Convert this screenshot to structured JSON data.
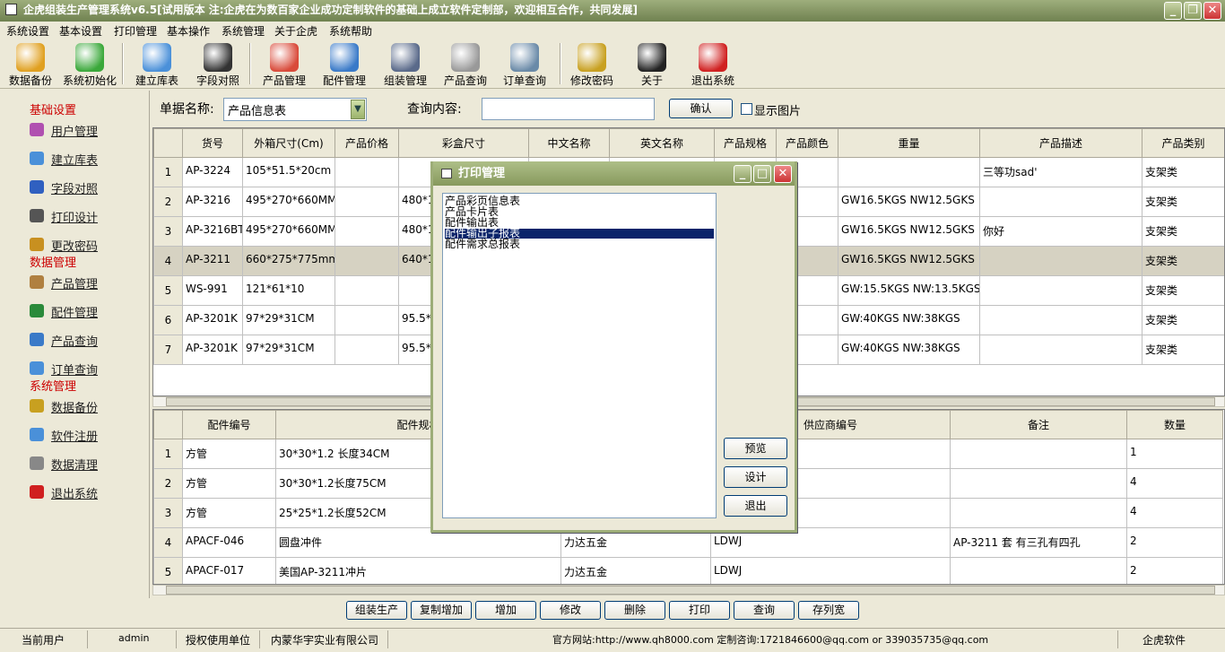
{
  "window": {
    "title": "企虎组装生产管理系统v6.5[试用版本 注:企虎在为数百家企业成功定制软件的基础上成立软件定制部，欢迎相互合作，共同发展]"
  },
  "menu": [
    "系统设置",
    "基本设置",
    "打印管理",
    "基本操作",
    "系统管理",
    "关于企虎",
    "系统帮助"
  ],
  "toolbar": [
    {
      "label": "数据备份",
      "icon": "database-backup-icon",
      "color": "#e0a020"
    },
    {
      "label": "系统初始化",
      "icon": "refresh-icon",
      "color": "#3aa83a"
    },
    {
      "label": "建立库表",
      "icon": "form-icon",
      "color": "#4a90d9"
    },
    {
      "label": "字段对照",
      "icon": "amazon-a-icon",
      "color": "#333333"
    },
    {
      "label": "产品管理",
      "icon": "chrome-icon",
      "color": "#d94a3a"
    },
    {
      "label": "配件管理",
      "icon": "tools-icon",
      "color": "#3a7ac8"
    },
    {
      "label": "组装管理",
      "icon": "database-icon",
      "color": "#5a6a8a"
    },
    {
      "label": "产品查询",
      "icon": "magnifier-icon",
      "color": "#999999"
    },
    {
      "label": "订单查询",
      "icon": "database-search-icon",
      "color": "#6a8aa8"
    },
    {
      "label": "修改密码",
      "icon": "lock-icon",
      "color": "#c8a020"
    },
    {
      "label": "关于",
      "icon": "gnome-icon",
      "color": "#222222"
    },
    {
      "label": "退出系统",
      "icon": "cube-exit-icon",
      "color": "#d02020"
    }
  ],
  "sidebar": {
    "sections": [
      {
        "title": "基础设置",
        "items": [
          {
            "label": "用户管理",
            "color": "#b050b0"
          },
          {
            "label": "建立库表",
            "color": "#4a90d9"
          },
          {
            "label": "字段对照",
            "color": "#3060c0"
          },
          {
            "label": "打印设计",
            "color": "#555555"
          },
          {
            "label": "更改密码",
            "color": "#c89020"
          }
        ]
      },
      {
        "title": "数据管理",
        "items": [
          {
            "label": "产品管理",
            "color": "#b08040"
          },
          {
            "label": "配件管理",
            "color": "#2a8a3a"
          },
          {
            "label": "产品查询",
            "color": "#3a7ac8"
          },
          {
            "label": "订单查询",
            "color": "#4a90d9"
          }
        ]
      },
      {
        "title": "系统管理",
        "items": [
          {
            "label": "数据备份",
            "color": "#c8a020"
          },
          {
            "label": "软件注册",
            "color": "#4a90d9"
          },
          {
            "label": "数据清理",
            "color": "#888888"
          },
          {
            "label": "退出系统",
            "color": "#d02020"
          }
        ]
      }
    ]
  },
  "search": {
    "doc_label": "单据名称:",
    "doc_value": "产品信息表",
    "query_label": "查询内容:",
    "query_value": "",
    "confirm": "确认",
    "show_pic": "显示图片"
  },
  "top_grid": {
    "columns": [
      "货号",
      "外箱尺寸(Cm)",
      "产品价格",
      "彩盒尺寸",
      "中文名称",
      "英文名称",
      "产品规格",
      "产品颜色",
      "重量",
      "产品描述",
      "产品类别"
    ],
    "rows": [
      {
        "n": "1",
        "c": [
          "AP-3224",
          "105*51.5*20cm",
          "",
          "",
          "",
          "",
          "",
          "",
          "",
          "三等功sad'",
          "支架类"
        ]
      },
      {
        "n": "2",
        "c": [
          "AP-3216",
          "495*270*660MM",
          "",
          "480*1",
          "",
          "",
          "",
          "",
          "GW16.5KGS NW12.5GKS",
          "",
          "支架类"
        ]
      },
      {
        "n": "3",
        "c": [
          "AP-3216BT",
          "495*270*660MM",
          "",
          "480*1",
          "",
          "",
          "",
          "",
          "GW16.5KGS NW12.5GKS",
          "你好",
          "支架类"
        ]
      },
      {
        "n": "4",
        "c": [
          "AP-3211",
          "660*275*775mm",
          "",
          "640*1",
          "",
          "",
          "",
          "",
          "GW16.5KGS NW12.5GKS",
          "",
          "支架类"
        ]
      },
      {
        "n": "5",
        "c": [
          "WS-991",
          "121*61*10",
          "",
          "",
          "",
          "",
          "",
          "",
          "GW:15.5KGS NW:13.5KGS",
          "",
          "支架类"
        ]
      },
      {
        "n": "6",
        "c": [
          "AP-3201K",
          "97*29*31CM",
          "",
          "95.5*9",
          "",
          "",
          "",
          "",
          "GW:40KGS  NW:38KGS",
          "",
          "支架类"
        ]
      },
      {
        "n": "7",
        "c": [
          "AP-3201K",
          "97*29*31CM",
          "",
          "95.5*9",
          "",
          "",
          "",
          "",
          "GW:40KGS  NW:38KGS",
          "",
          "支架类"
        ]
      }
    ]
  },
  "bottom_grid": {
    "columns": [
      "配件编号",
      "配件规格",
      "",
      "供应商编号",
      "备注",
      "数量"
    ],
    "rows": [
      {
        "n": "1",
        "c": [
          "方管",
          "30*30*1.2  长度34CM",
          "",
          "",
          "",
          "1"
        ]
      },
      {
        "n": "2",
        "c": [
          "方管",
          "30*30*1.2长度75CM",
          "",
          "",
          "",
          "4"
        ]
      },
      {
        "n": "3",
        "c": [
          "方管",
          "25*25*1.2长度52CM",
          "",
          "",
          "",
          "4"
        ]
      },
      {
        "n": "4",
        "c": [
          "APACF-046",
          "圆盘冲件",
          "力达五金",
          "LDWJ",
          "AP-3211   套 有三孔有四孔",
          "2"
        ]
      },
      {
        "n": "5",
        "c": [
          "APACF-017",
          "美国AP-3211冲片",
          "力达五金",
          "LDWJ",
          "",
          "2"
        ]
      }
    ]
  },
  "actions": [
    "组装生产",
    "复制增加",
    "增加",
    "修改",
    "删除",
    "打印",
    "查询",
    "存列宽"
  ],
  "status": {
    "user_label": "当前用户",
    "user": "admin",
    "unit_label": "授权使用单位",
    "unit": "内蒙华宇实业有限公司",
    "contact": "官方网站:http://www.qh8000.com 定制咨询:1721846600@qq.com or 339035735@qq.com",
    "brand": "企虎软件"
  },
  "dialog": {
    "title": "打印管理",
    "items": [
      "产品彩页信息表",
      "产品卡片表",
      "配件输出表",
      "配件输出子报表",
      "配件需求总报表"
    ],
    "selected_index": 3,
    "preview": "预览",
    "design": "设计",
    "exit": "退出"
  }
}
